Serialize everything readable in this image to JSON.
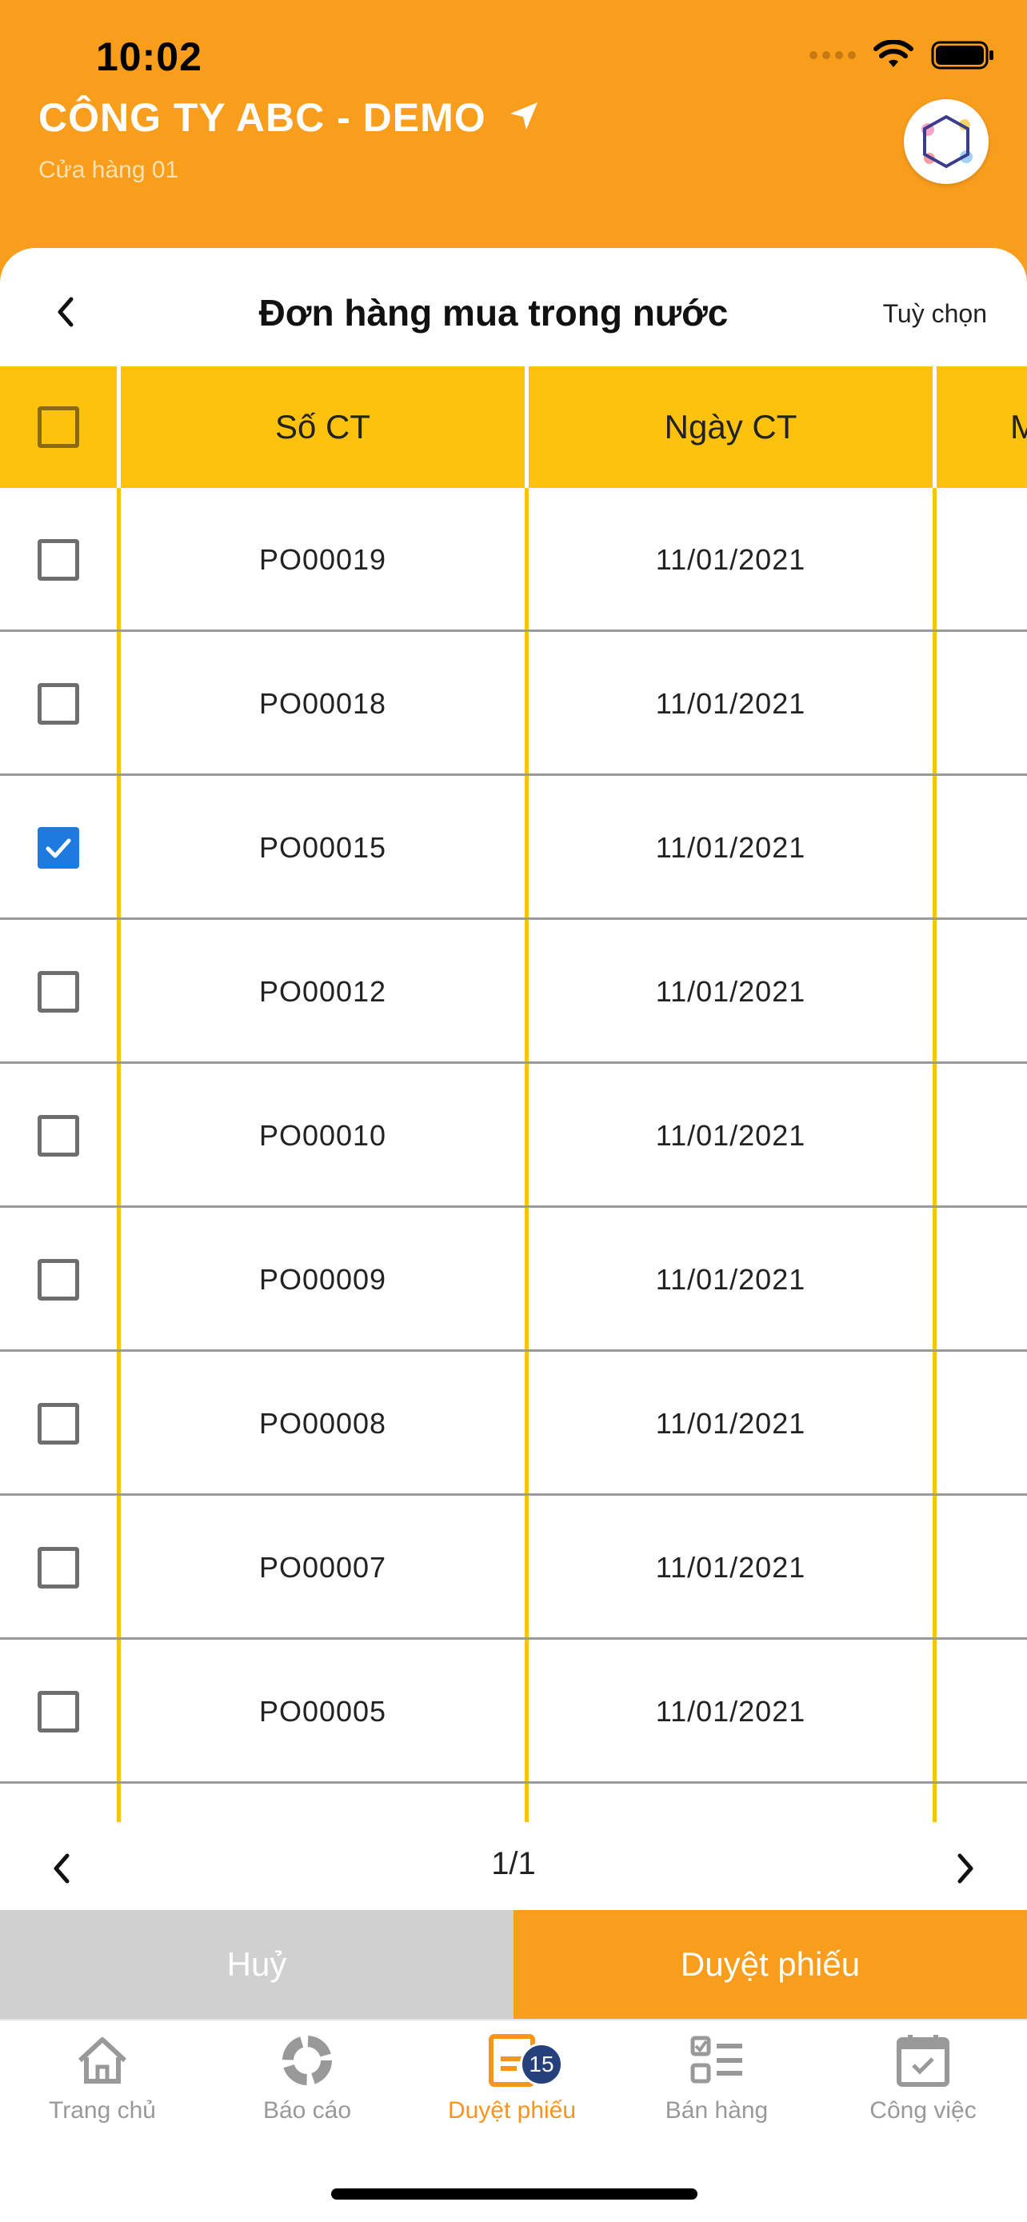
{
  "status_bar": {
    "time": "10:02"
  },
  "header": {
    "company": "CÔNG TY ABC - DEMO",
    "store": "Cửa hàng 01"
  },
  "page": {
    "title": "Đơn hàng mua trong nước",
    "options_label": "Tuỳ chọn"
  },
  "table": {
    "columns": [
      "Số CT",
      "Ngày CT",
      "M"
    ],
    "rows": [
      {
        "so_ct": "PO00019",
        "ngay_ct": "11/01/2021",
        "checked": false
      },
      {
        "so_ct": "PO00018",
        "ngay_ct": "11/01/2021",
        "checked": false
      },
      {
        "so_ct": "PO00015",
        "ngay_ct": "11/01/2021",
        "checked": true
      },
      {
        "so_ct": "PO00012",
        "ngay_ct": "11/01/2021",
        "checked": false
      },
      {
        "so_ct": "PO00010",
        "ngay_ct": "11/01/2021",
        "checked": false
      },
      {
        "so_ct": "PO00009",
        "ngay_ct": "11/01/2021",
        "checked": false
      },
      {
        "so_ct": "PO00008",
        "ngay_ct": "11/01/2021",
        "checked": false
      },
      {
        "so_ct": "PO00007",
        "ngay_ct": "11/01/2021",
        "checked": false
      },
      {
        "so_ct": "PO00005",
        "ngay_ct": "11/01/2021",
        "checked": false
      }
    ]
  },
  "pager": {
    "page": "1/1"
  },
  "actions": {
    "cancel": "Huỷ",
    "approve": "Duyệt phiếu"
  },
  "tabs": [
    {
      "label": "Trang chủ",
      "icon": "home-icon",
      "active": false
    },
    {
      "label": "Báo cáo",
      "icon": "report-icon",
      "active": false
    },
    {
      "label": "Duyệt phiếu",
      "icon": "document-icon",
      "active": true,
      "badge": "15"
    },
    {
      "label": "Bán hàng",
      "icon": "checklist-icon",
      "active": false
    },
    {
      "label": "Công việc",
      "icon": "calendar-icon",
      "active": false
    }
  ],
  "colors": {
    "brand_orange": "#f99d1c",
    "table_yellow": "#fcc20d",
    "checked_blue": "#1f7ae0",
    "badge_navy": "#25407a"
  }
}
